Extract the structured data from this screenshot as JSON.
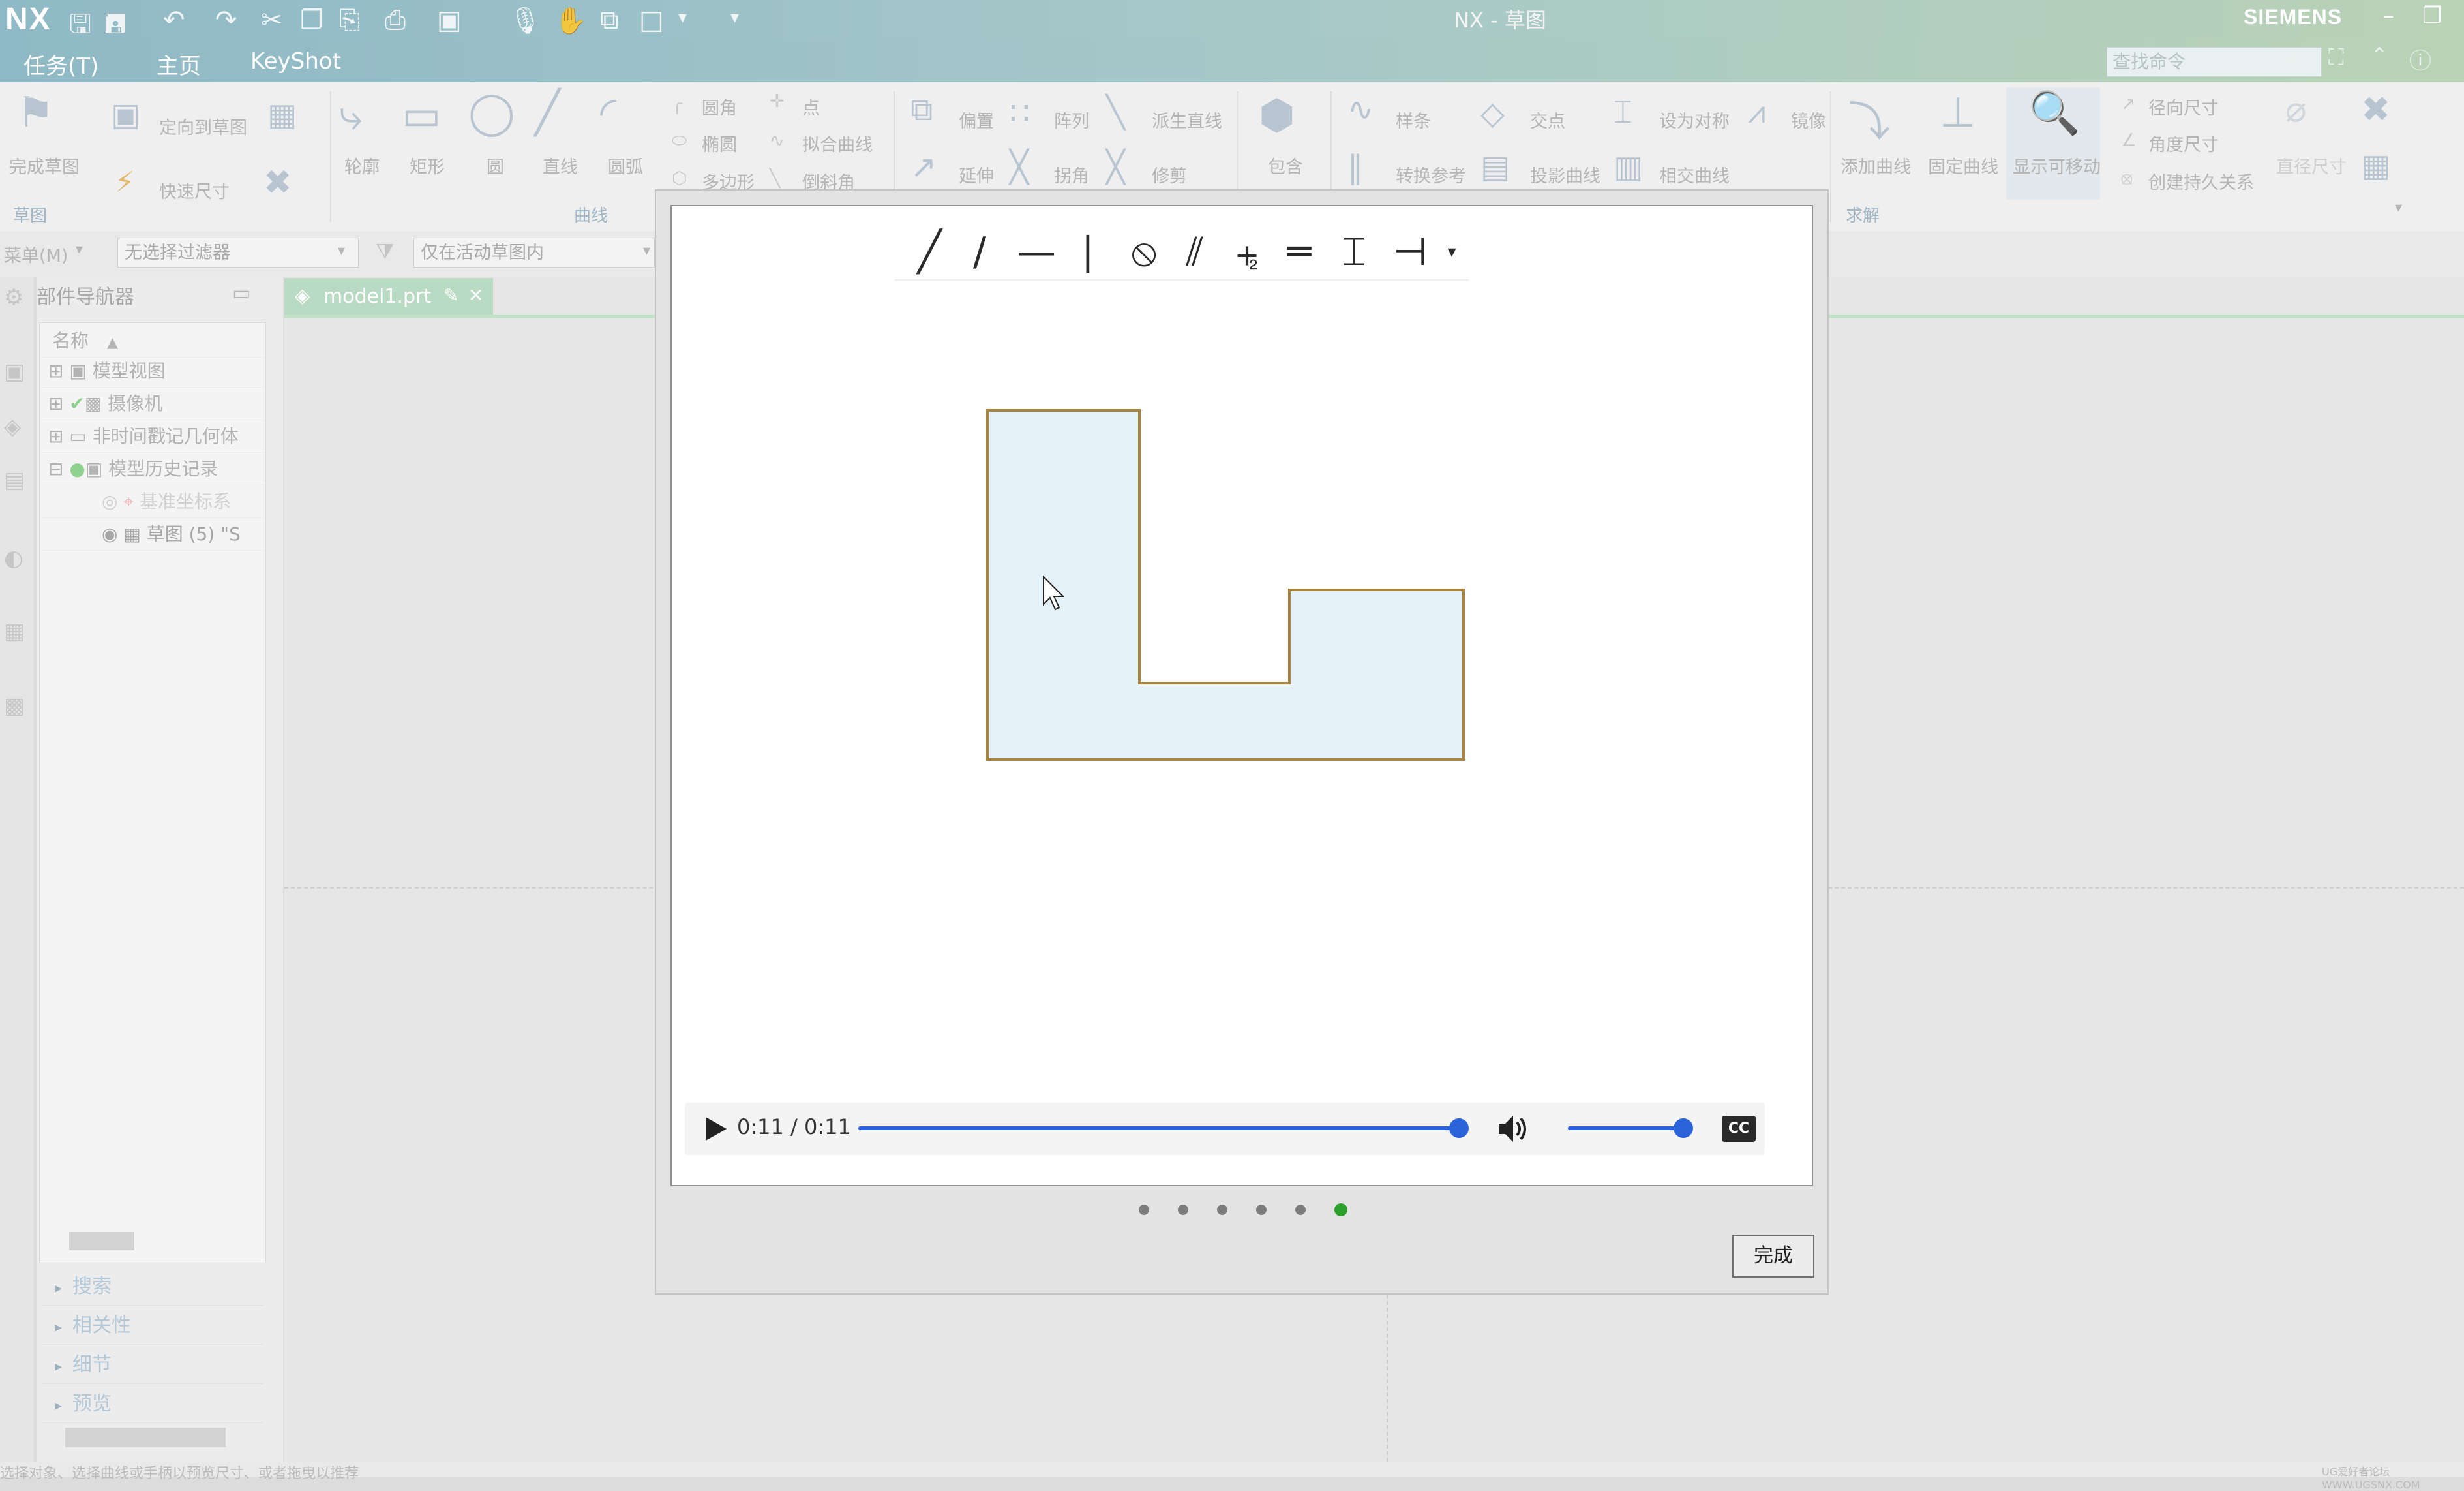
{
  "app": {
    "logo": "NX",
    "window_title": "NX - 草图",
    "brand": "SIEMENS"
  },
  "tabs": [
    {
      "label": "任务(T)"
    },
    {
      "label": "主页"
    },
    {
      "label": "KeyShot"
    }
  ],
  "command_search": {
    "placeholder": "查找命令"
  },
  "ribbon": {
    "finish_sketch": "完成草图",
    "orient_to_sketch": "定向到草图",
    "quick_dimension": "快速尺寸",
    "sketch_group": "草图",
    "profile": "轮廓",
    "rectangle": "矩形",
    "circle": "圆",
    "line": "直线",
    "arc": "圆弧",
    "fillet": "圆角",
    "ellipse": "椭圆",
    "polygon": "多边形",
    "point": "点",
    "fit_curve": "拟合曲线",
    "chamfer": "倒斜角",
    "curve_group": "曲线",
    "offset": "偏置",
    "pattern": "阵列",
    "derived_line": "派生直线",
    "extend": "延伸",
    "corner": "拐角",
    "trim": "修剪",
    "include": "包含",
    "spline": "样条",
    "intersection_point": "交点",
    "make_symmetric": "设为对称",
    "mirror": "镜像",
    "convert_reference": "转换参考",
    "project_curve": "投影曲线",
    "intersection_curve": "相交曲线",
    "add_curve": "添加曲线",
    "fix_curve": "固定曲线",
    "show_movable": "显示可移动",
    "radial_dimension": "径向尺寸",
    "angular_dimension": "角度尺寸",
    "create_persistent_relation": "创建持久关系",
    "diameter_dimension": "直径尺寸",
    "solve_group": "求解"
  },
  "filter_row": {
    "menu": "菜单(M)",
    "selection_filter": "无选择过滤器",
    "scope": "仅在活动草图内"
  },
  "navigator": {
    "title": "部件导航器",
    "column_name": "名称",
    "rows": [
      "模型视图",
      "摄像机",
      "非时间戳记几何体",
      "模型历史记录",
      "基准坐标系",
      "草图 (5) \"S"
    ],
    "sections": [
      "搜索",
      "相关性",
      "细节",
      "预览"
    ]
  },
  "document_tab": {
    "name": "model1.prt"
  },
  "video": {
    "time": "0:11 / 0:11",
    "progress": 1.0,
    "volume": 1.0,
    "cc_label": "CC"
  },
  "pagination": {
    "count": 6,
    "active_index": 5
  },
  "dialog": {
    "done_label": "完成"
  },
  "status_bar": {
    "message": "选择对象、选择曲线或手柄以预览尺寸、或者拖曳以推荐",
    "watermark": "UG爱好者论坛 WWW.UGSNX.COM"
  },
  "colors": {
    "accent": "#2a63d9",
    "pagination_active": "#2ca02c",
    "sketch_stroke": "#a98441",
    "sketch_fill": "#e4f1f8"
  }
}
